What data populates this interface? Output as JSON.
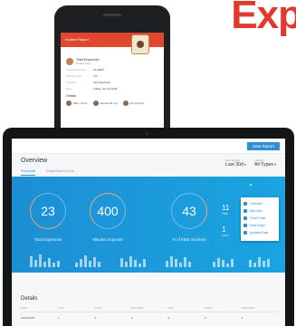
{
  "brand": {
    "word": "Exp"
  },
  "phone": {
    "header_title": "Incident Report",
    "user_name": "Total Exposures",
    "user_sub": "Details here",
    "rows": [
      {
        "key": "Incident Number",
        "value": "IN-18827"
      },
      {
        "key": "Incident Type",
        "value": "Yes"
      },
      {
        "key": "Location",
        "value": "123 Street Rd"
      },
      {
        "key": "Date",
        "value": "Friday, Oct 12 2018"
      }
    ],
    "section_title": "Details",
    "people": [
      "Mary Jones",
      "Samantha Lee",
      "Tom Peters"
    ]
  },
  "tablet": {
    "new_report_label": "New Report",
    "overview_title": "Overview",
    "tabs": [
      "Personal",
      "Department Wide"
    ],
    "date_select": {
      "label": "Date Range",
      "value": "Last 30d"
    },
    "type_select": {
      "label": "Incident",
      "value": "All Types"
    },
    "stats": [
      {
        "value": "23",
        "label": "Total Exposures"
      },
      {
        "value": "400",
        "label": "Minutes Exposed"
      },
      {
        "value": "43",
        "label": "% of EMS Incidents"
      }
    ],
    "mini_stats": [
      {
        "value": "11",
        "label": "Total"
      },
      {
        "value": "1",
        "label": "Level"
      }
    ],
    "dropdown_items": [
      "Overview",
      "Stat View",
      "Trend Chart",
      "Heat Graph",
      "Updated Data"
    ],
    "details_title": "Details",
    "details_columns": [
      "DATE",
      "TYPE",
      "TOTAL",
      "EXPOSED",
      "MINS",
      "LEVEL",
      "PERSONAL"
    ],
    "details_row": [
      "10/02/2018",
      "1",
      "4",
      "4",
      "9",
      "3",
      "4"
    ]
  }
}
